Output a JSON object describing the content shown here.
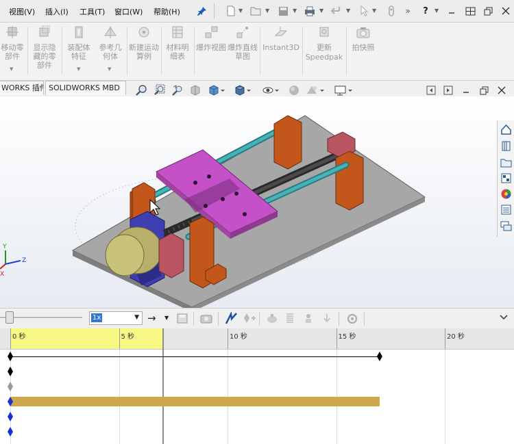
{
  "menubar": {
    "items": [
      {
        "label": "视图(V)"
      },
      {
        "label": "插入(I)"
      },
      {
        "label": "工具(T)"
      },
      {
        "label": "窗口(W)"
      },
      {
        "label": "帮助(H)"
      }
    ],
    "overflow_label": "»"
  },
  "ribbon": {
    "buttons": [
      {
        "label": "移动零部件",
        "icon": "move-component-icon"
      },
      {
        "label": "显示隐藏的零部件",
        "icon": "show-hidden-components-icon"
      },
      {
        "label": "装配体特征",
        "icon": "assembly-features-icon"
      },
      {
        "label": "参考几何体",
        "icon": "reference-geometry-icon"
      },
      {
        "label": "新建运动算例",
        "icon": "new-motion-study-icon"
      },
      {
        "label": "材料明细表",
        "icon": "bill-of-materials-icon"
      },
      {
        "label": "爆炸视图",
        "icon": "exploded-view-icon"
      },
      {
        "label": "爆炸直线草图",
        "icon": "explode-line-sketch-icon"
      },
      {
        "label": "Instant3D",
        "icon": "instant3d-icon"
      },
      {
        "label": "更新Speedpak",
        "icon": "update-speedpak-icon"
      },
      {
        "label": "拍快照",
        "icon": "snapshot-icon"
      }
    ]
  },
  "tabs": {
    "items": [
      {
        "label": "WORKS 插件"
      },
      {
        "label": "SOLIDWORKS MBD"
      }
    ]
  },
  "view_toolbar": {
    "icons": [
      "zoom-to-fit-icon",
      "zoom-area-icon",
      "previous-view-icon",
      "section-view-icon",
      "view-orientation-icon",
      "display-style-icon",
      "hide-show-items-icon",
      "edit-appearance-icon",
      "apply-scene-icon",
      "view-settings-icon"
    ]
  },
  "triad": {
    "x_label": "X",
    "y_label": "Y",
    "z_label": "Z"
  },
  "motion_toolbar": {
    "playback_speed": "1x"
  },
  "timeline": {
    "ticks": [
      {
        "label": "0 秒",
        "seconds": 0
      },
      {
        "label": "5 秒",
        "seconds": 5
      },
      {
        "label": "10 秒",
        "seconds": 10
      },
      {
        "label": "15 秒",
        "seconds": 15
      },
      {
        "label": "20 秒",
        "seconds": 20
      }
    ],
    "time_bar_seconds": 7.0,
    "end_key_seconds": 17.0,
    "rows": [
      {
        "type": "duration-line",
        "color": "#000000"
      },
      {
        "type": "key",
        "color": "#000000"
      },
      {
        "type": "key",
        "color": "#9a9a9a"
      },
      {
        "type": "bar",
        "color": "#d0a84c"
      },
      {
        "type": "key",
        "color": "#1a2fd6"
      },
      {
        "type": "key",
        "color": "#1a2fd6"
      }
    ]
  },
  "colors": {
    "selection_highlight": "#f8f884",
    "part_orange": "#c2561b",
    "part_magenta": "#c451c8",
    "rod_teal": "#3aa3a9",
    "base_plate": "#a9a9a9",
    "motor_housing": "#3e3fb0",
    "motor_body": "#c9c27a"
  }
}
